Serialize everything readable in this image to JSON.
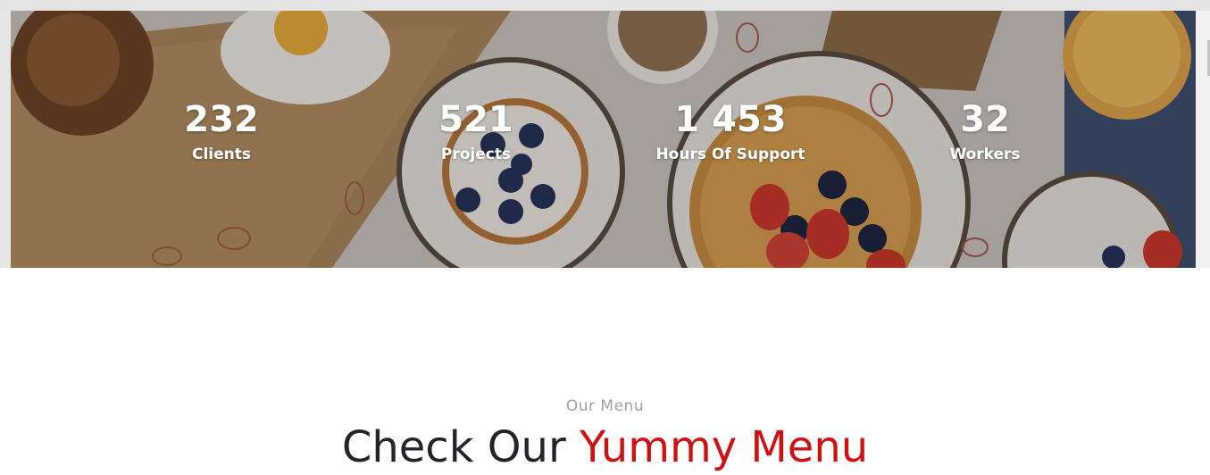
{
  "stats": [
    {
      "value": "232",
      "label": "Clients"
    },
    {
      "value": "521",
      "label": "Projects"
    },
    {
      "value": "1 453",
      "label": "Hours Of Support"
    },
    {
      "value": "32",
      "label": "Workers"
    }
  ],
  "menu_section": {
    "eyebrow": "Our Menu",
    "heading_main": "Check Our",
    "heading_accent": "Yummy Menu"
  },
  "colors": {
    "accent": "#ce1212",
    "heading": "#212529",
    "eyebrow": "#a0a0a0"
  }
}
